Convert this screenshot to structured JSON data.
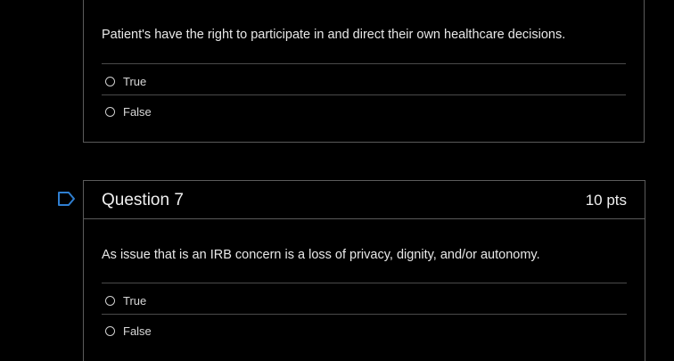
{
  "question6": {
    "text": "Patient's have the right to participate in and direct their own healthcare decisions.",
    "answers": [
      "True",
      "False"
    ]
  },
  "question7": {
    "title": "Question 7",
    "points": "10 pts",
    "text": "As issue that is an IRB concern is a loss of privacy, dignity, and/or autonomy.",
    "answers": [
      "True",
      "False"
    ]
  },
  "colors": {
    "background": "#000000",
    "border": "#5b5b5b",
    "divider": "#4a4a4a",
    "text": "#e8e8e8"
  }
}
